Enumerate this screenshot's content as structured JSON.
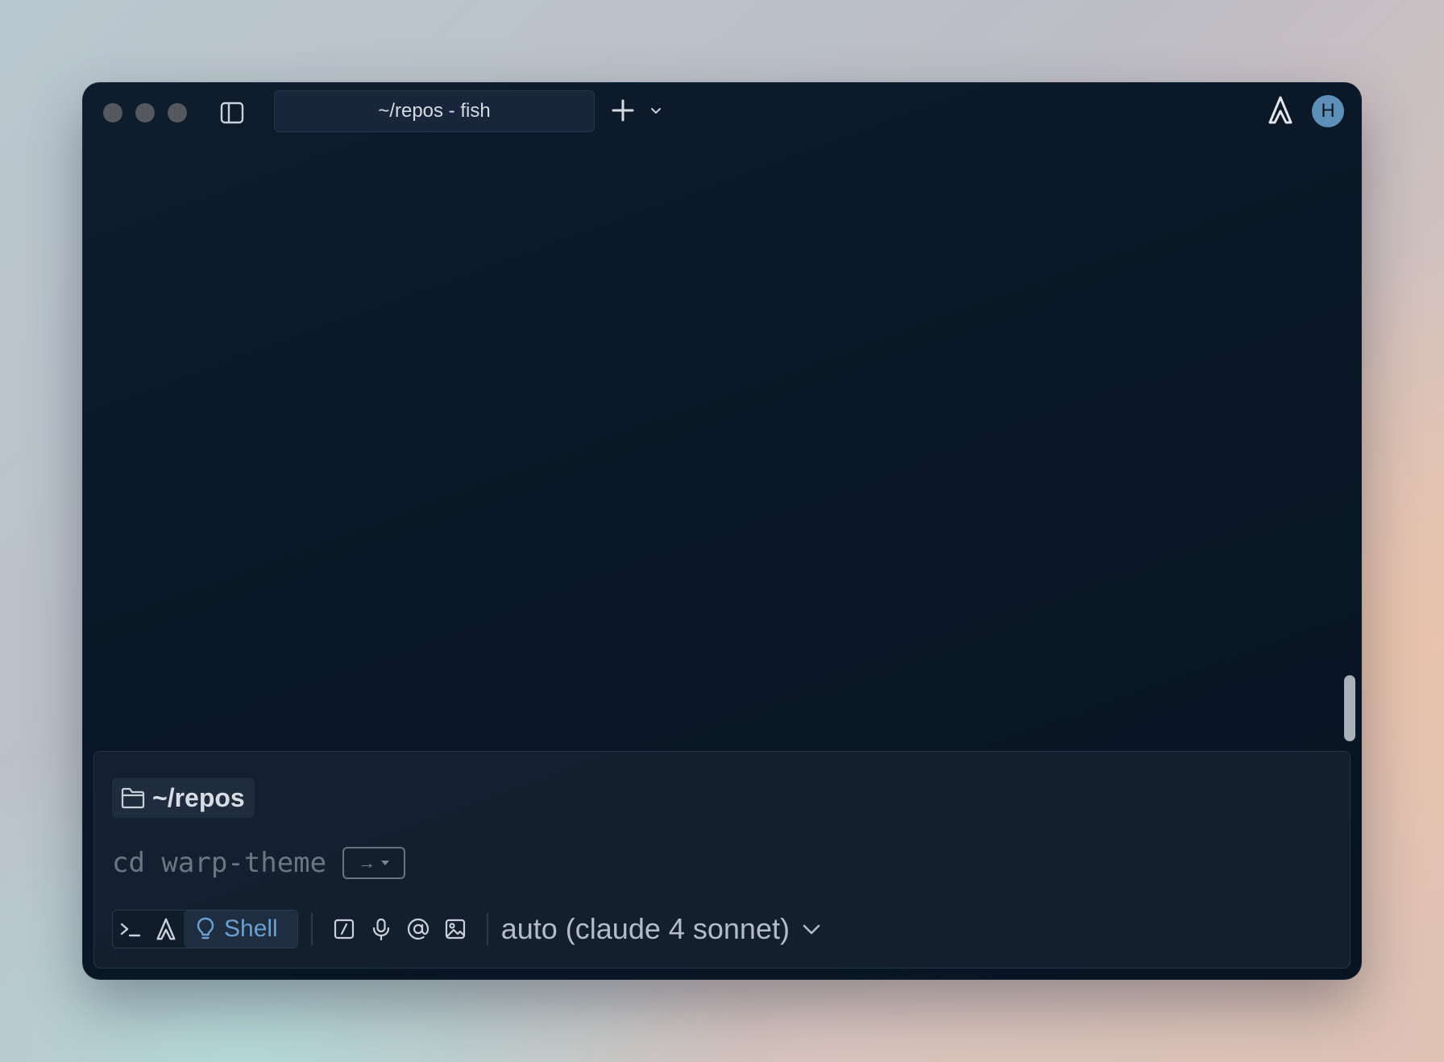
{
  "window": {
    "tab_title": "~/repos - fish",
    "avatar_initial": "H"
  },
  "input": {
    "current_directory": "~/repos",
    "command_suggestion": "cd warp-theme",
    "accept_hint_arrow": "→",
    "mode_label": "Shell",
    "model_label": "auto (claude 4 sonnet)"
  },
  "icons": {
    "sidebar": "sidebar-toggle-icon",
    "new_tab": "plus-icon",
    "tab_menu": "chevron-down-icon",
    "warp": "warp-logo-icon",
    "folder": "folder-icon",
    "terminal": "terminal-prompt-icon",
    "agent": "warp-agent-icon",
    "shell_mode": "lightbulb-icon",
    "slash_commands": "slash-command-icon",
    "voice": "microphone-icon",
    "mention": "at-sign-icon",
    "image": "image-attach-icon"
  },
  "colors": {
    "window_bg": "#0a1726",
    "shell_accent": "#6aa0d0",
    "avatar_bg": "#5e8fb8"
  }
}
